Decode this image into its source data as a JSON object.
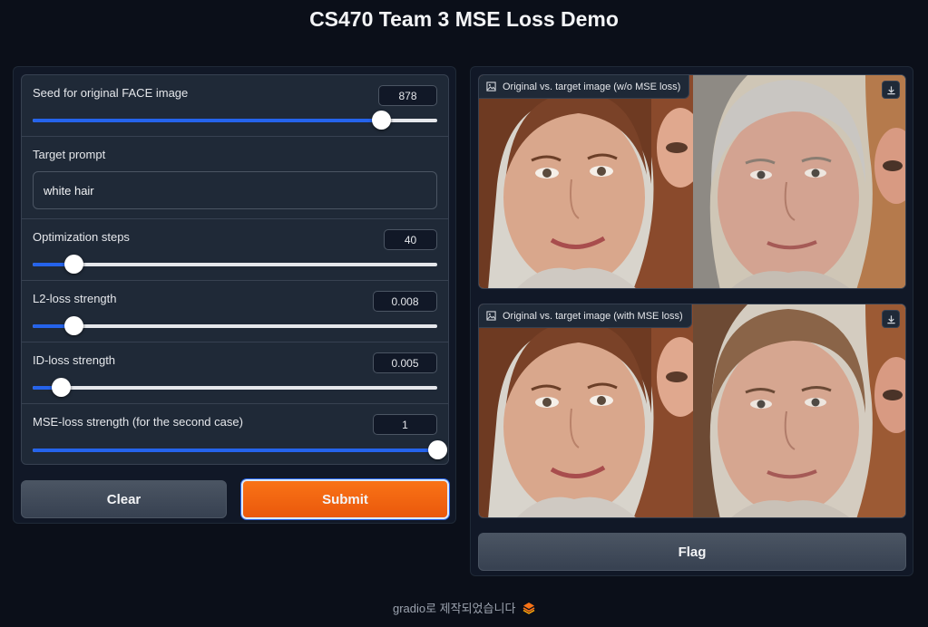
{
  "header": {
    "title": "CS470 Team 3 MSE Loss Demo"
  },
  "inputs": {
    "seed": {
      "label": "Seed for original FACE image",
      "value": "878",
      "fraction": 0.86
    },
    "prompt": {
      "label": "Target prompt",
      "value": "white hair"
    },
    "steps": {
      "label": "Optimization steps",
      "value": "40",
      "fraction": 0.1
    },
    "l2": {
      "label": "L2-loss strength",
      "value": "0.008",
      "fraction": 0.1
    },
    "id": {
      "label": "ID-loss strength",
      "value": "0.005",
      "fraction": 0.07
    },
    "mse": {
      "label": "MSE-loss strength (for the second case)",
      "value": "1",
      "fraction": 1.0
    }
  },
  "buttons": {
    "clear": "Clear",
    "submit": "Submit",
    "flag": "Flag"
  },
  "outputs": {
    "image1": {
      "label": "Original vs. target image (w/o MSE loss)"
    },
    "image2": {
      "label": "Original vs. target image (with MSE loss)"
    }
  },
  "footer": {
    "text": "gradio로 제작되었습니다"
  },
  "colors": {
    "accent": "#2563eb",
    "primary": "#ea580c",
    "background": "#0b0f19"
  }
}
